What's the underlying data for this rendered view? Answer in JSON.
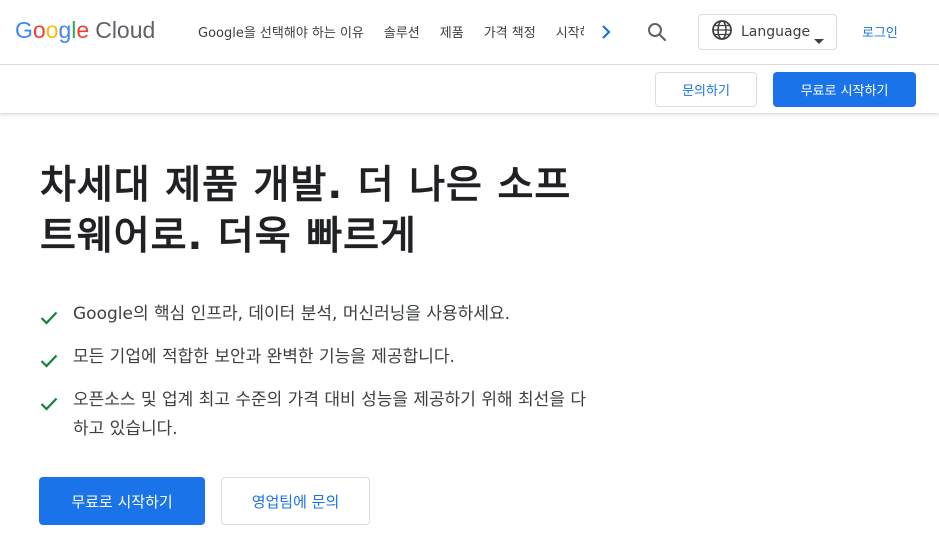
{
  "header": {
    "logo": {
      "g1": "G",
      "g2": "o",
      "g3": "o",
      "g4": "g",
      "g5": "l",
      "g6": "e",
      "cloud": "Cloud"
    },
    "nav": [
      {
        "label": "Google을 선택해야 하는 이유"
      },
      {
        "label": "솔루션"
      },
      {
        "label": "제품"
      },
      {
        "label": "가격 책정"
      },
      {
        "label": "시작하기"
      }
    ],
    "nav_more_icon": "chevron-right-icon",
    "search_icon": "search-icon",
    "language": {
      "label": "Language",
      "icon": "globe-icon",
      "caret": "caret-down-icon"
    },
    "signin_label": "로그인"
  },
  "subbar": {
    "contact_label": "문의하기",
    "start_label": "무료로 시작하기"
  },
  "hero": {
    "title_line1": "차세대 제품 개발. 더 나은 소프",
    "title_line2": "트웨어로. 더욱 빠르게",
    "features": [
      {
        "text": "Google의 핵심 인프라, 데이터 분석, 머신러닝을 사용하세요."
      },
      {
        "text": "모든 기업에 적합한 보안과 완벽한 기능을 제공합니다."
      },
      {
        "text": "오픈소스 및 업계 최고 수준의 가격 대비 성능을 제공하기 위해 최선을 다하고 있습니다."
      }
    ],
    "primary_cta": "무료로 시작하기",
    "secondary_cta": "영업팀에 문의"
  },
  "colors": {
    "accent": "#1a73e8",
    "check": "#188038",
    "text": "#202124",
    "muted": "#3c4043",
    "border": "#dadce0"
  }
}
